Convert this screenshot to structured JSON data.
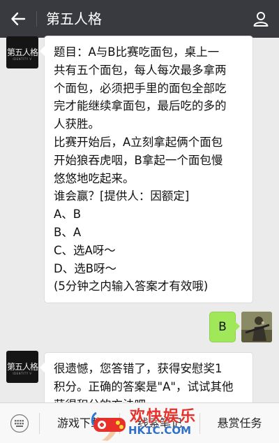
{
  "header": {
    "title": "第五人格",
    "back_icon": "arrow-left-icon",
    "profile_icon": "person-icon"
  },
  "messages": [
    {
      "sender": "bot",
      "avatar_text": "第五人格",
      "avatar_sub": "IDENTITY V",
      "lines": [
        "题目：A与B比赛吃面包，桌上一",
        "共有五个面包，每人每次最多拿两",
        "个面包，必须把手里的面包全部吃",
        "完才能继续拿面包，最后吃的多的",
        "人获胜。",
        "比赛开始后，A立刻拿起俩个面包",
        "开始狼吞虎咽，B拿起一个面包慢",
        "悠悠地吃起来。",
        "谁会赢？[提供人：因额定]",
        "A、B",
        "B、A",
        "C、选A呀～",
        "D、选B呀～",
        "(5分钟之内输入答案才有效哦)"
      ]
    },
    {
      "sender": "me",
      "text": "B"
    },
    {
      "sender": "bot",
      "avatar_text": "第五人格",
      "avatar_sub": "IDENTITY V",
      "lines": [
        "很遗憾，您答错了，获得安慰奖1",
        "积分。正确的答案是\"A\"，试试其他",
        "获得积分的方法吧"
      ]
    }
  ],
  "bottom_menu": {
    "keyboard_icon": "keyboard-icon",
    "items": [
      "游戏下载",
      "线索笔记",
      "悬赏任务"
    ]
  },
  "watermark": {
    "line1": "欢快娱乐",
    "line2": "HK1C.COM"
  },
  "colors": {
    "header_bg": "#393a3f",
    "chat_bg": "#ebebeb",
    "my_bubble": "#a0e75a",
    "watermark_red": "#e8302a"
  }
}
